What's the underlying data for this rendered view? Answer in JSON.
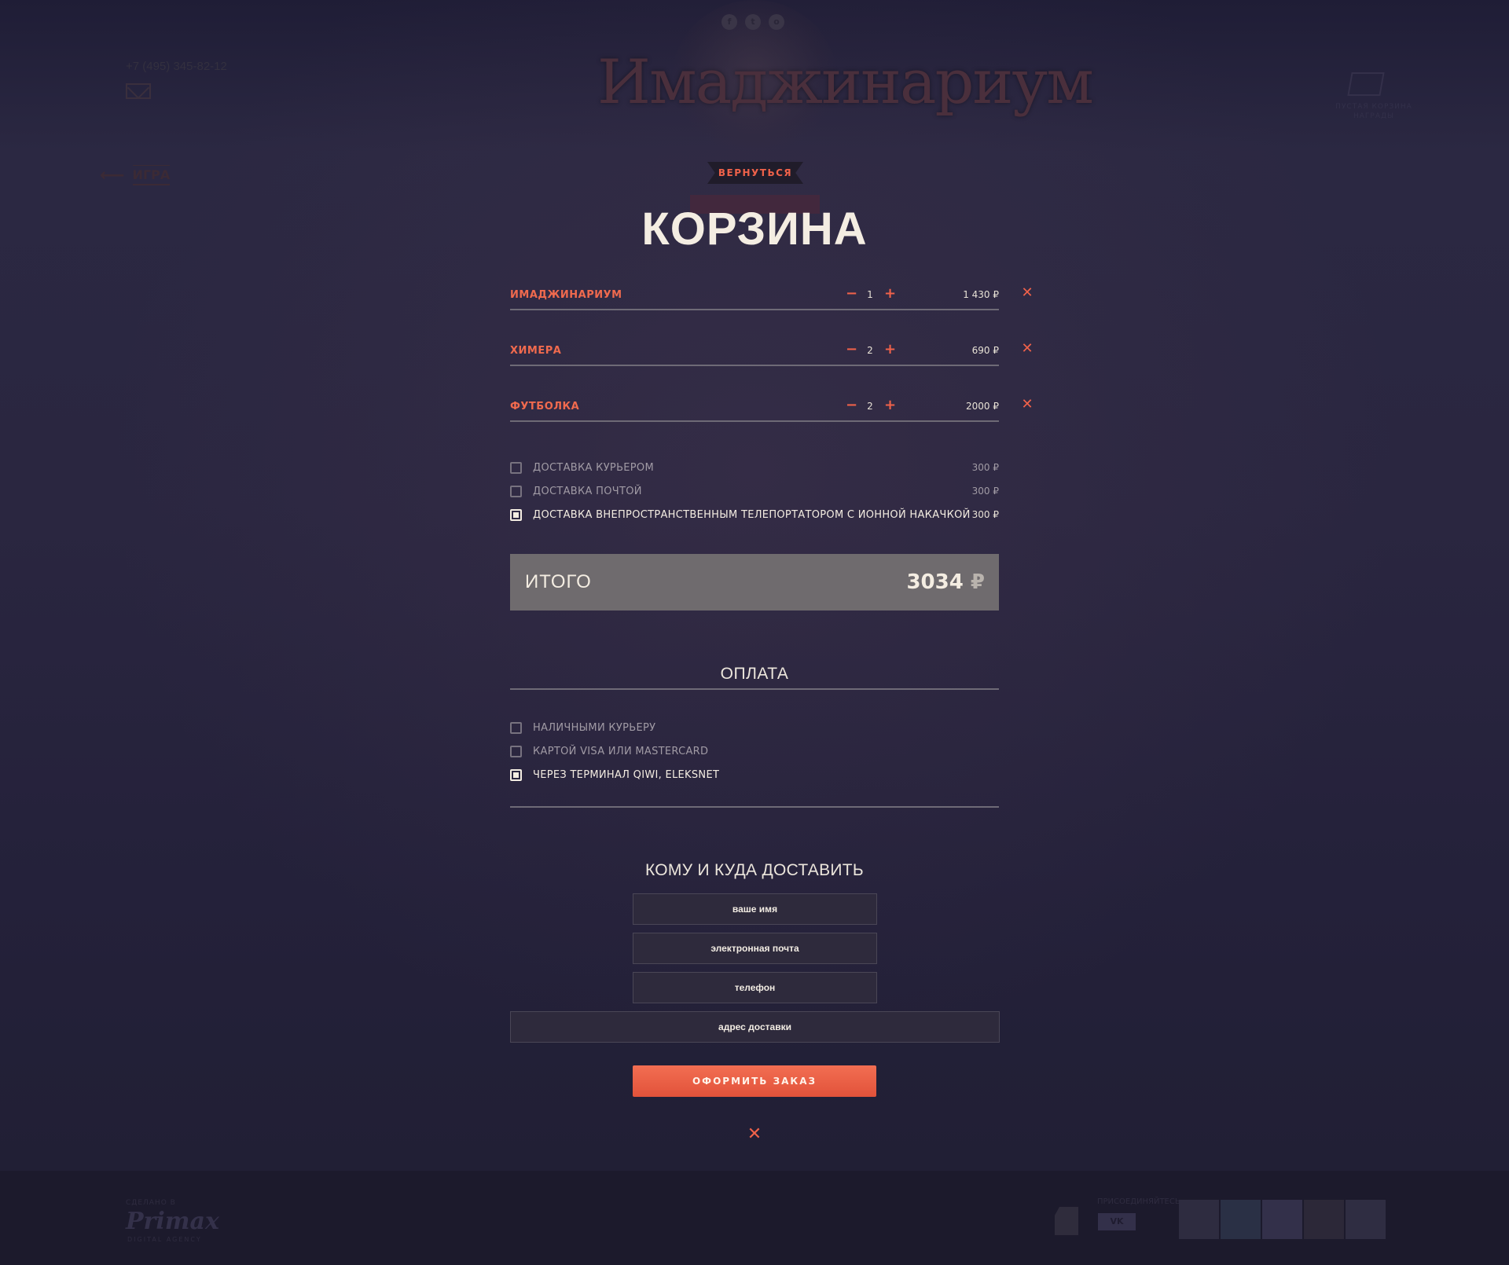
{
  "header": {
    "social": [
      "f",
      "t",
      "o"
    ],
    "logo_text": "Имаджинариум",
    "phone": "+7 (495) 345-82-12",
    "cart_caption": [
      "ПУСТАЯ КОРЗИНА",
      "НАГРАДЫ"
    ],
    "back_link_label": "ИГРА"
  },
  "page": {
    "ribbon_label": "ВЕРНУТЬСЯ",
    "title": "КОРЗИНА"
  },
  "cart": {
    "items": [
      {
        "name": "ИМАДЖИНАРИУМ",
        "qty": "1",
        "price": "1 430 ₽"
      },
      {
        "name": "ХИМЕРА",
        "qty": "2",
        "price": "690 ₽"
      },
      {
        "name": "ФУТБОЛКА",
        "qty": "2",
        "price": "2000 ₽"
      }
    ],
    "minus_symbol": "−",
    "plus_symbol": "+",
    "remove_symbol": "✕"
  },
  "delivery": {
    "options": [
      {
        "label": "ДОСТАВКА КУРЬЕРОМ",
        "price": "300 ₽",
        "checked": false
      },
      {
        "label": "ДОСТАВКА ПОЧТОЙ",
        "price": "300 ₽",
        "checked": false
      },
      {
        "label": "ДОСТАВКА ВНЕПРОСТРАНСТВЕННЫМ ТЕЛЕПОРТАТОРОМ С ИОННОЙ НАКАЧКОЙ",
        "price": "300 ₽",
        "checked": true
      }
    ]
  },
  "total": {
    "label": "ИТОГО",
    "amount": "3034",
    "currency": "₽"
  },
  "payment": {
    "title": "ОПЛАТА",
    "options": [
      {
        "label": "НАЛИЧНЫМИ КУРЬЕРУ",
        "checked": false
      },
      {
        "label": "КАРТОЙ VISA ИЛИ MASTERCARD",
        "checked": false
      },
      {
        "label": "ЧЕРЕЗ ТЕРМИНАЛ QIWI, ELEKSNET",
        "checked": true
      }
    ]
  },
  "form": {
    "title": "КОМУ И КУДА ДОСТАВИТЬ",
    "name_placeholder": "ваше имя",
    "email_placeholder": "электронная почта",
    "phone_placeholder": "телефон",
    "address_placeholder": "адрес доставки",
    "submit_label": "ОФОРМИТЬ ЗАКАЗ",
    "close_symbol": "✕"
  },
  "footer": {
    "made_in": "СДЕЛАНО В",
    "agency_name": "Primax",
    "agency_sub": "DIGITAL AGENCY",
    "join_label": "ПРИСОЕДИНЯЙТЕСЬ",
    "vk_label": "VK"
  },
  "colors": {
    "accent": "#f0624a",
    "text": "#f4ede2",
    "total_bg": "#6f6b6e",
    "background": "#24213a"
  }
}
